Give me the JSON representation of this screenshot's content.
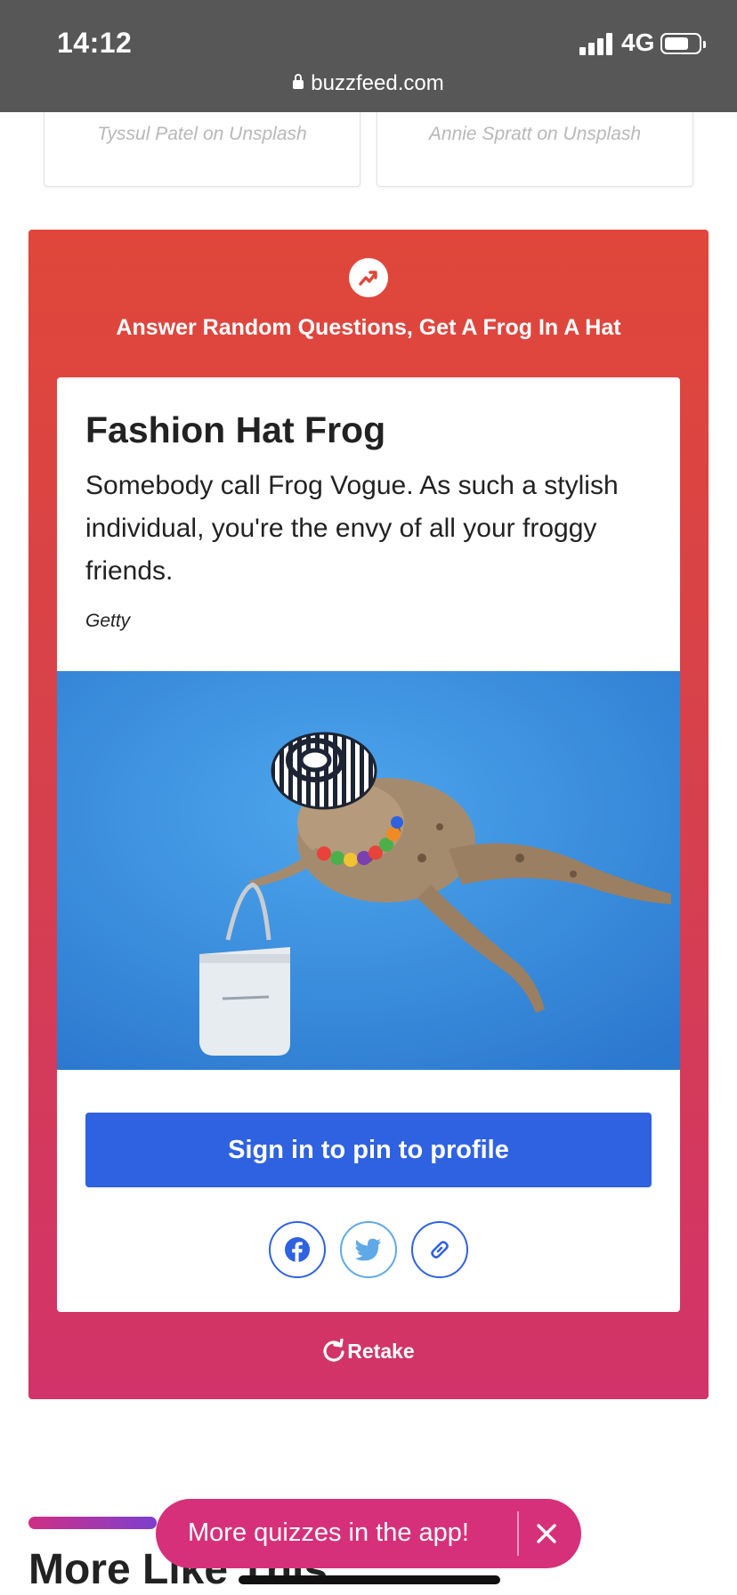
{
  "status_bar": {
    "time": "14:12",
    "network": "4G",
    "url": "buzzfeed.com"
  },
  "photo_credits": [
    {
      "name": "Tyssul Patel",
      "joiner": "on",
      "source": "Unsplash"
    },
    {
      "name": "Annie Spratt",
      "joiner": "on",
      "source": "Unsplash"
    }
  ],
  "quiz": {
    "badge_icon": "trending-icon",
    "title": "Answer Random Questions, Get A Frog In A Hat",
    "result": {
      "heading": "Fashion Hat Frog",
      "description": "Somebody call Frog Vogue. As such a stylish individual, you're the envy of all your froggy friends.",
      "image_credit": "Getty"
    },
    "pin_button_label": "Sign in to pin to profile",
    "share_icons": [
      "facebook-icon",
      "twitter-icon",
      "link-icon"
    ],
    "retake_label": "Retake"
  },
  "more_like_this": {
    "heading": "More Like This"
  },
  "app_promo": {
    "label": "More quizzes in the app!"
  },
  "colors": {
    "panel_top": "#e0473a",
    "panel_bottom": "#d2336a",
    "primary_button": "#2f62e1",
    "promo_pill": "#d7307a",
    "status_bar": "#575757"
  }
}
